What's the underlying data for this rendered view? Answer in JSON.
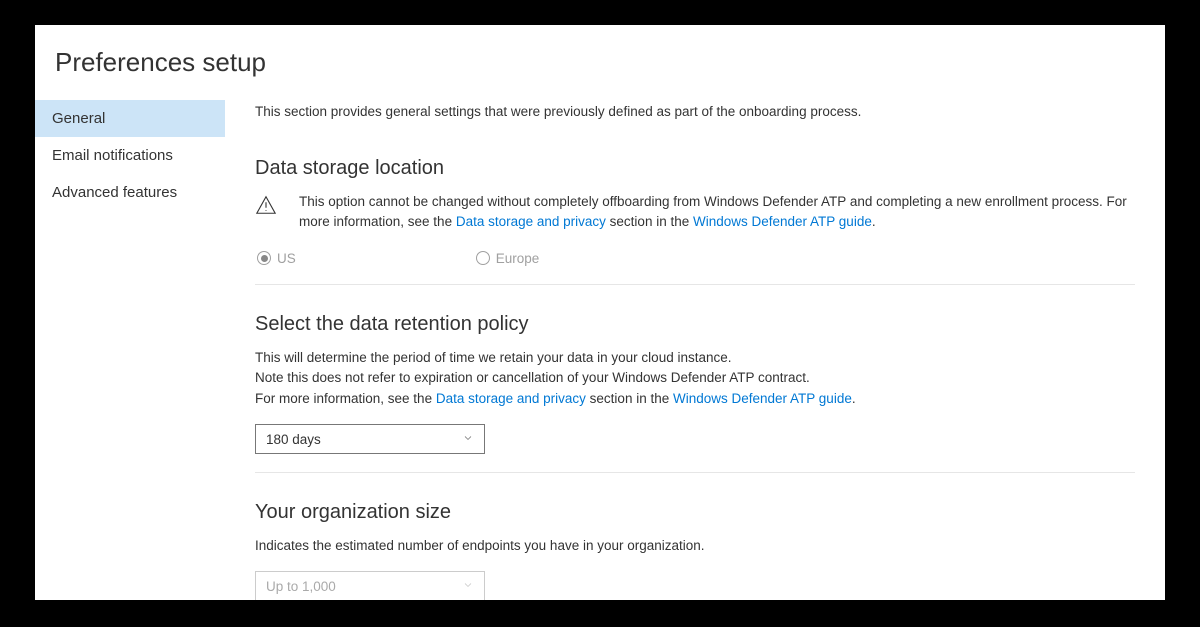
{
  "page_title": "Preferences setup",
  "sidebar": {
    "items": [
      {
        "label": "General",
        "active": true
      },
      {
        "label": "Email notifications",
        "active": false
      },
      {
        "label": "Advanced features",
        "active": false
      }
    ]
  },
  "intro": "This section provides general settings that were previously defined as part of the onboarding process.",
  "storage": {
    "heading": "Data storage location",
    "warning_pre": "This option cannot be changed without completely offboarding from Windows Defender ATP and completing a new enrollment process. For more information, see the ",
    "link1": "Data storage and privacy",
    "warning_mid": " section in the ",
    "link2": "Windows Defender ATP guide",
    "warning_post": ".",
    "options": [
      {
        "label": "US",
        "selected": true
      },
      {
        "label": "Europe",
        "selected": false
      }
    ]
  },
  "retention": {
    "heading": "Select the data retention policy",
    "line1": "This will determine the period of time we retain your data in your cloud instance.",
    "line2": "Note this does not refer to expiration or cancellation of your Windows Defender ATP contract.",
    "line3_pre": "For more information, see the ",
    "link1": "Data storage and privacy",
    "line3_mid": " section in the ",
    "link2": "Windows Defender ATP guide",
    "line3_post": ".",
    "selected": "180 days"
  },
  "orgsize": {
    "heading": "Your organization size",
    "desc": "Indicates the estimated number of endpoints you have in your organization.",
    "selected": "Up to 1,000"
  }
}
